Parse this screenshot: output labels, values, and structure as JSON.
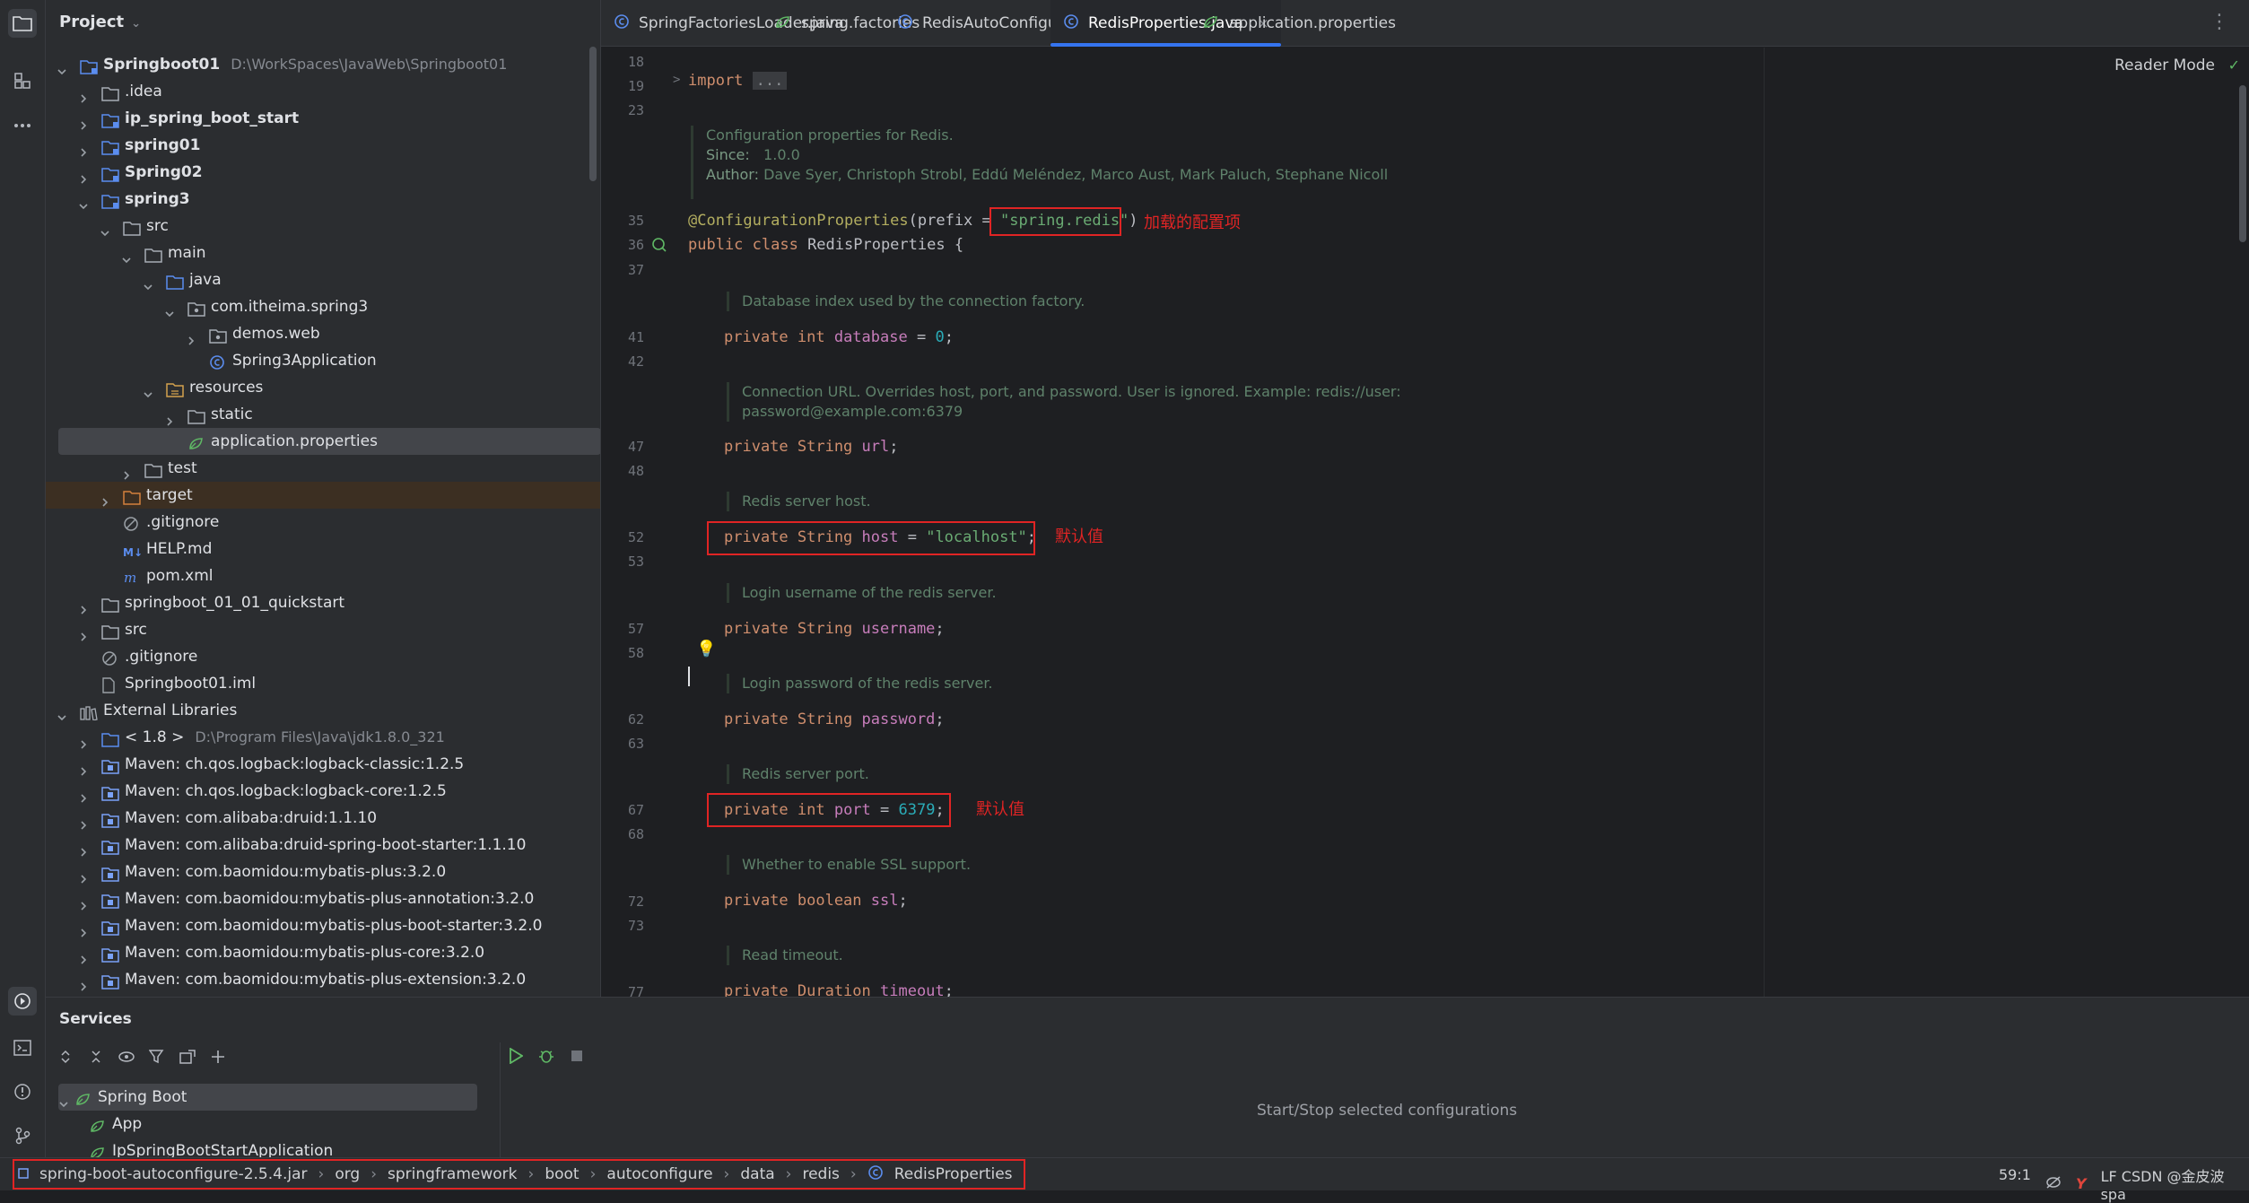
{
  "project_panel": {
    "title": "Project",
    "tree": [
      {
        "depth": 0,
        "label": "Springboot01",
        "bold": true,
        "path": "D:\\WorkSpaces\\JavaWeb\\Springboot01",
        "icon": "module",
        "arrow": "down"
      },
      {
        "depth": 1,
        "label": ".idea",
        "icon": "folder",
        "arrow": "right"
      },
      {
        "depth": 1,
        "label": "ip_spring_boot_start",
        "bold": true,
        "icon": "module",
        "arrow": "right"
      },
      {
        "depth": 1,
        "label": "spring01",
        "bold": true,
        "icon": "module",
        "arrow": "right"
      },
      {
        "depth": 1,
        "label": "Spring02",
        "bold": true,
        "icon": "module",
        "arrow": "right"
      },
      {
        "depth": 1,
        "label": "spring3",
        "bold": true,
        "icon": "module",
        "arrow": "down"
      },
      {
        "depth": 2,
        "label": "src",
        "icon": "folder",
        "arrow": "down"
      },
      {
        "depth": 3,
        "label": "main",
        "icon": "folder",
        "arrow": "down"
      },
      {
        "depth": 4,
        "label": "java",
        "icon": "src-folder",
        "arrow": "down"
      },
      {
        "depth": 5,
        "label": "com.itheima.spring3",
        "icon": "package",
        "arrow": "down"
      },
      {
        "depth": 6,
        "label": "demos.web",
        "icon": "package",
        "arrow": "right"
      },
      {
        "depth": 6,
        "label": "Spring3Application",
        "icon": "class",
        "arrow": ""
      },
      {
        "depth": 4,
        "label": "resources",
        "icon": "res-folder",
        "arrow": "down"
      },
      {
        "depth": 5,
        "label": "static",
        "icon": "folder",
        "arrow": "right"
      },
      {
        "depth": 5,
        "label": "application.properties",
        "icon": "props",
        "arrow": "",
        "selected": true
      },
      {
        "depth": 3,
        "label": "test",
        "icon": "folder",
        "arrow": "right"
      },
      {
        "depth": 2,
        "label": "target",
        "icon": "excluded-folder",
        "arrow": "right",
        "highlight": true
      },
      {
        "depth": 2,
        "label": ".gitignore",
        "icon": "ignore",
        "arrow": ""
      },
      {
        "depth": 2,
        "label": "HELP.md",
        "icon": "md",
        "arrow": ""
      },
      {
        "depth": 2,
        "label": "pom.xml",
        "icon": "maven",
        "arrow": ""
      },
      {
        "depth": 1,
        "label": "springboot_01_01_quickstart",
        "icon": "folder",
        "arrow": "right"
      },
      {
        "depth": 1,
        "label": "src",
        "icon": "folder",
        "arrow": "right"
      },
      {
        "depth": 1,
        "label": ".gitignore",
        "icon": "ignore",
        "arrow": ""
      },
      {
        "depth": 1,
        "label": "Springboot01.iml",
        "icon": "file",
        "arrow": ""
      },
      {
        "depth": 0,
        "label": "External Libraries",
        "icon": "library",
        "arrow": "down"
      },
      {
        "depth": 1,
        "label": "< 1.8 >",
        "path": "D:\\Program Files\\Java\\jdk1.8.0_321",
        "icon": "jdk",
        "arrow": "right"
      },
      {
        "depth": 1,
        "label": "Maven: ch.qos.logback:logback-classic:1.2.5",
        "icon": "jar",
        "arrow": "right"
      },
      {
        "depth": 1,
        "label": "Maven: ch.qos.logback:logback-core:1.2.5",
        "icon": "jar",
        "arrow": "right"
      },
      {
        "depth": 1,
        "label": "Maven: com.alibaba:druid:1.1.10",
        "icon": "jar",
        "arrow": "right"
      },
      {
        "depth": 1,
        "label": "Maven: com.alibaba:druid-spring-boot-starter:1.1.10",
        "icon": "jar",
        "arrow": "right"
      },
      {
        "depth": 1,
        "label": "Maven: com.baomidou:mybatis-plus:3.2.0",
        "icon": "jar",
        "arrow": "right"
      },
      {
        "depth": 1,
        "label": "Maven: com.baomidou:mybatis-plus-annotation:3.2.0",
        "icon": "jar",
        "arrow": "right"
      },
      {
        "depth": 1,
        "label": "Maven: com.baomidou:mybatis-plus-boot-starter:3.2.0",
        "icon": "jar",
        "arrow": "right"
      },
      {
        "depth": 1,
        "label": "Maven: com.baomidou:mybatis-plus-core:3.2.0",
        "icon": "jar",
        "arrow": "right"
      },
      {
        "depth": 1,
        "label": "Maven: com.baomidou:mybatis-plus-extension:3.2.0",
        "icon": "jar",
        "arrow": "right"
      }
    ]
  },
  "tabs": [
    {
      "label": "SpringFactoriesLoader.java",
      "icon": "class-icon"
    },
    {
      "label": "spring.factories",
      "icon": "spring-file-icon"
    },
    {
      "label": "RedisAutoConfiguration.java",
      "icon": "class-icon"
    },
    {
      "label": "RedisProperties.java",
      "icon": "class-icon",
      "active": true,
      "close": "×"
    },
    {
      "label": "application.properties",
      "icon": "spring-file-icon"
    }
  ],
  "editor": {
    "reader_mode": "Reader Mode",
    "check_mark": "✓",
    "line_numbers": [
      "18",
      "19",
      "23",
      "35",
      "36",
      "37",
      "41",
      "42",
      "47",
      "48",
      "52",
      "53",
      "57",
      "58",
      "62",
      "63",
      "67",
      "68",
      "72",
      "73",
      "77"
    ],
    "fold_marker": ">",
    "import_kw": "import",
    "import_dots": "...",
    "class_doc": {
      "line1": "Configuration properties for Redis.",
      "since_label": "Since:",
      "since_value": "1.0.0",
      "author_label": "Author:",
      "author_value": "Dave Syer, Christoph Strobl, Eddú Meléndez, Marco Aust, Mark Paluch, Stephane Nicoll"
    },
    "annotation": "@ConfigurationProperties",
    "annotation_open": "(prefix = ",
    "prefix_value": "\"spring.redis\"",
    "annotation_close": ")",
    "class_decl_kw": "public class",
    "class_name": " RedisProperties {",
    "docs": {
      "database": "Database index used by the connection factory.",
      "url_1": "Connection URL. Overrides host, port, and password. User is ignored. Example: redis://user:",
      "url_2": "password@example.com:6379",
      "host": "Redis server host.",
      "username": "Login username of the redis server.",
      "password": "Login password of the redis server.",
      "port": "Redis server port.",
      "ssl": "Whether to enable SSL support.",
      "timeout": "Read timeout."
    },
    "fields": {
      "database": {
        "mod": "private int ",
        "name": "database",
        "rest": " = ",
        "val": "0",
        "end": ";"
      },
      "url": {
        "mod": "private String ",
        "name": "url",
        "end": ";"
      },
      "host": {
        "mod": "private String ",
        "name": "host",
        "rest": " = ",
        "val": "\"localhost\"",
        "end": ";"
      },
      "username": {
        "mod": "private String ",
        "name": "username",
        "end": ";"
      },
      "password": {
        "mod": "private String ",
        "name": "password",
        "end": ";"
      },
      "port": {
        "mod": "private int ",
        "name": "port",
        "rest": " = ",
        "val": "6379",
        "end": ";"
      },
      "ssl": {
        "mod": "private boolean ",
        "name": "ssl",
        "end": ";"
      },
      "timeout": {
        "mod": "private Duration ",
        "name": "timeout",
        "end": ";"
      }
    },
    "notes": {
      "prefix": "加载的配置项",
      "host_default": "默认值",
      "port_default": "默认值"
    }
  },
  "services": {
    "title": "Services",
    "tree": [
      {
        "label": "Spring Boot",
        "selected": true
      },
      {
        "label": "App"
      },
      {
        "label": "IpSpringBootStartApplication"
      }
    ],
    "empty_text": "Start/Stop selected configurations"
  },
  "status_bar": {
    "breadcrumbs": [
      "spring-boot-autoconfigure-2.5.4.jar",
      "org",
      "springframework",
      "boot",
      "autoconfigure",
      "data",
      "redis",
      "RedisProperties"
    ],
    "separator": "›",
    "caret_position": "59:1",
    "right_text": "LF  CSDN @金皮波spa"
  },
  "colors": {
    "accent": "#3574f0",
    "annotation_red": "#e02424"
  }
}
